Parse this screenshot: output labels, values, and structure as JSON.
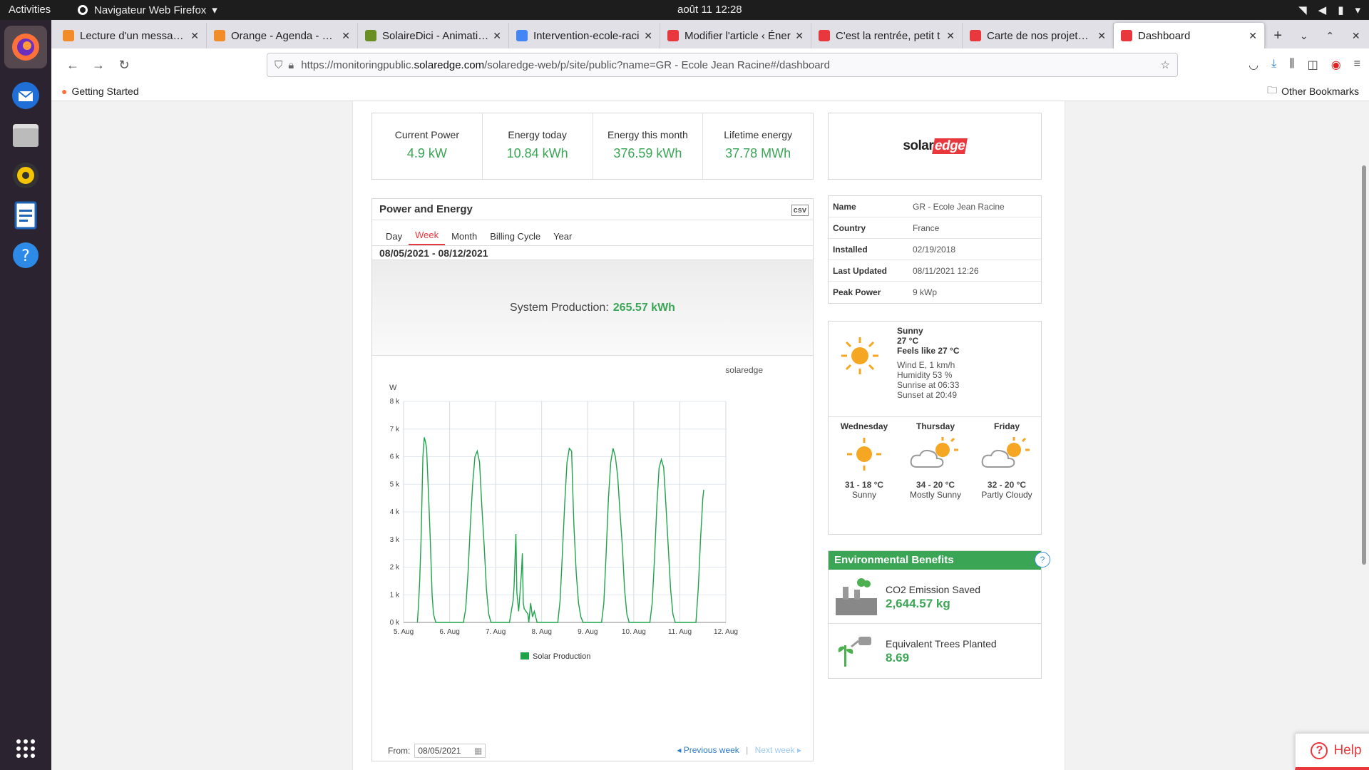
{
  "os": {
    "activities": "Activities",
    "app_name": "Navigateur Web Firefox",
    "clock": "août 11  12:28"
  },
  "tabs": [
    {
      "label": "Lecture d'un message -",
      "color": "#f28c28"
    },
    {
      "label": "Orange - Agenda - aoû",
      "color": "#f28c28"
    },
    {
      "label": "SolaireDici - Animation",
      "color": "#6b8e23"
    },
    {
      "label": "Intervention-ecole-raci",
      "color": "#4285f4"
    },
    {
      "label": "Modifier l'article ‹ Éner",
      "color": "#e8383d"
    },
    {
      "label": "C'est la rentrée, petit t",
      "color": "#e8383d"
    },
    {
      "label": "Carte de nos projets - É",
      "color": "#e8383d"
    },
    {
      "label": "Dashboard",
      "color": "#e8383d",
      "selected": true
    }
  ],
  "url": {
    "pre": "https://monitoringpublic.",
    "host": "solaredge.com",
    "post": "/solaredge-web/p/site/public?name=GR - Ecole Jean Racine#/dashboard"
  },
  "bookmarks": {
    "getting_started": "Getting Started",
    "other": "Other Bookmarks"
  },
  "kpis": [
    {
      "label": "Current Power",
      "value": "4.9 kW"
    },
    {
      "label": "Energy today",
      "value": "10.84 kWh"
    },
    {
      "label": "Energy this month",
      "value": "376.59 kWh"
    },
    {
      "label": "Lifetime energy",
      "value": "37.78 MWh"
    }
  ],
  "logo": {
    "solar": "solar",
    "edge": "edge"
  },
  "site_info": [
    {
      "k": "Name",
      "v": "GR - Ecole Jean Racine"
    },
    {
      "k": "Country",
      "v": "France"
    },
    {
      "k": "Installed",
      "v": "02/19/2018"
    },
    {
      "k": "Last Updated",
      "v": "08/11/2021 12:26"
    },
    {
      "k": "Peak Power",
      "v": "9 kWp"
    }
  ],
  "weather": {
    "cond": "Sunny",
    "temp": "27 °C",
    "feels": "Feels like 27 °C",
    "wind": "Wind E, 1 km/h",
    "humidity": "Humidity 53 %",
    "sunrise": "Sunrise at 06:33",
    "sunset": "Sunset at 20:49",
    "forecast": [
      {
        "day": "Wednesday",
        "temps": "31 - 18 °C",
        "cond": "Sunny",
        "icon": "sun-icon"
      },
      {
        "day": "Thursday",
        "temps": "34 - 20 °C",
        "cond": "Mostly Sunny",
        "icon": "partly-cloudy-icon"
      },
      {
        "day": "Friday",
        "temps": "32 - 20 °C",
        "cond": "Partly Cloudy",
        "icon": "partly-cloudy-icon"
      }
    ]
  },
  "env": {
    "title": "Environmental Benefits",
    "help": "?",
    "co2_label": "CO2 Emission Saved",
    "co2_value": "2,644.57 kg",
    "trees_label": "Equivalent Trees Planted",
    "trees_value": "8.69"
  },
  "power_energy": {
    "title": "Power and Energy",
    "tabs": [
      "Day",
      "Week",
      "Month",
      "Billing Cycle",
      "Year"
    ],
    "active_tab": "Week",
    "range": "08/05/2021 - 08/12/2021",
    "sys_label": "System Production:",
    "sys_value": "265.57 kWh",
    "from_label": "From:",
    "from_value": "08/05/2021",
    "prev": "Previous week",
    "next": "Next week",
    "sep": "|"
  },
  "chart_data": {
    "type": "line",
    "ylabel": "W",
    "ylim": [
      0,
      8000
    ],
    "yticks": [
      "0 k",
      "1 k",
      "2 k",
      "3 k",
      "4 k",
      "5 k",
      "6 k",
      "7 k",
      "8 k"
    ],
    "xticks": [
      "5. Aug",
      "6. Aug",
      "7. Aug",
      "8. Aug",
      "9. Aug",
      "10. Aug",
      "11. Aug",
      "12. Aug"
    ],
    "grid": true,
    "legend": "bottom",
    "series": [
      {
        "name": "Solar Production",
        "color": "#1fa34a",
        "x": [
          0.3,
          0.32,
          0.35,
          0.38,
          0.4,
          0.42,
          0.45,
          0.48,
          0.5,
          0.52,
          0.55,
          0.58,
          0.6,
          0.62,
          0.65,
          0.7,
          0.75,
          0.8,
          0.85,
          0.9,
          1.3,
          1.35,
          1.4,
          1.45,
          1.5,
          1.55,
          1.6,
          1.65,
          1.7,
          1.75,
          1.8,
          1.85,
          1.9,
          2.3,
          2.38,
          2.4,
          2.44,
          2.46,
          2.5,
          2.56,
          2.58,
          2.6,
          2.62,
          2.7,
          2.72,
          2.76,
          2.8,
          2.84,
          2.9,
          3.35,
          3.4,
          3.45,
          3.5,
          3.55,
          3.6,
          3.65,
          3.68,
          3.7,
          3.75,
          3.8,
          3.85,
          3.9,
          4.3,
          4.35,
          4.4,
          4.45,
          4.5,
          4.55,
          4.6,
          4.65,
          4.7,
          4.75,
          4.8,
          4.85,
          4.9,
          5.35,
          5.4,
          5.45,
          5.5,
          5.55,
          5.6,
          5.65,
          5.7,
          5.75,
          5.8,
          5.85,
          5.9,
          6.35,
          6.4,
          6.45,
          6.5,
          6.52
        ],
        "values": [
          0,
          500,
          1500,
          3000,
          4500,
          6000,
          6700,
          6500,
          6300,
          5500,
          4300,
          3000,
          2000,
          1000,
          300,
          0,
          0,
          0,
          0,
          0,
          0,
          500,
          1800,
          3500,
          5000,
          6000,
          6200,
          5800,
          4200,
          2800,
          1200,
          300,
          0,
          0,
          800,
          1300,
          3200,
          1100,
          400,
          1800,
          2500,
          700,
          500,
          300,
          0,
          700,
          200,
          400,
          0,
          0,
          800,
          2500,
          4300,
          5800,
          6300,
          6200,
          4500,
          3500,
          1800,
          700,
          200,
          0,
          0,
          700,
          2500,
          4500,
          5800,
          6300,
          6000,
          5300,
          4000,
          2800,
          1200,
          300,
          0,
          0,
          700,
          2300,
          4200,
          5600,
          5900,
          5600,
          4200,
          2700,
          1200,
          300,
          0,
          0,
          1200,
          3000,
          4500,
          4800
        ]
      }
    ]
  },
  "help": "Help"
}
